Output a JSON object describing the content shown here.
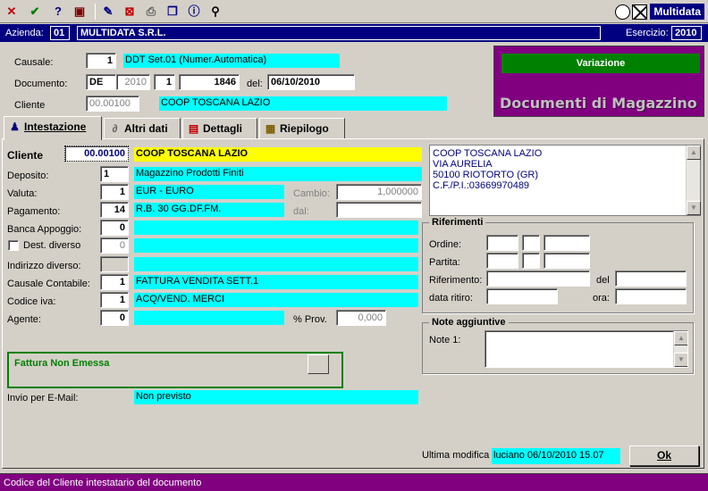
{
  "toolbar": {
    "icons": [
      "close-icon",
      "check-icon",
      "help-icon",
      "book-icon",
      "edit-icon",
      "delete-icon",
      "print-icon",
      "copy-icon",
      "info-icon",
      "search-icon"
    ],
    "brand": "Multidata"
  },
  "azienda": {
    "label": "Azienda:",
    "code": "01",
    "name": "MULTIDATA S.R.L.",
    "esercizio_label": "Esercizio:",
    "esercizio": "2010"
  },
  "header": {
    "causale_label": "Causale:",
    "causale_code": "1",
    "causale_desc": "DDT Set.01 (Numer.Automatica)",
    "documento_label": "Documento:",
    "doc_type": "DE",
    "doc_year": "2010",
    "doc_series": "1",
    "doc_number": "1846",
    "del_label": "del:",
    "doc_date": "06/10/2010",
    "cliente_label": "Cliente",
    "cliente_code": "00.00100",
    "cliente_name": "COOP TOSCANA LAZIO"
  },
  "panel": {
    "status": "Variazione",
    "title": "Documenti di Magazzino"
  },
  "tabs": [
    {
      "label": "Intestazione",
      "icon": "person-icon"
    },
    {
      "label": "Altri dati",
      "icon": "paperclip-icon"
    },
    {
      "label": "Dettagli",
      "icon": "list-icon"
    },
    {
      "label": "Riepilogo",
      "icon": "summary-icon"
    }
  ],
  "form": {
    "cliente_label": "Cliente",
    "cliente_code": "00.00100",
    "cliente_name": "COOP TOSCANA LAZIO",
    "deposito_label": "Deposito:",
    "deposito_code": "1",
    "deposito_desc": "Magazzino Prodotti Finiti",
    "valuta_label": "Valuta:",
    "valuta_code": "1",
    "valuta_desc": "EUR - EURO",
    "cambio_label": "Cambio:",
    "cambio_value": "1,000000",
    "pagamento_label": "Pagamento:",
    "pagamento_code": "14",
    "pagamento_desc": "R.B. 30 GG.DF.FM.",
    "dal_label": "dal:",
    "dal_value": "",
    "banca_label": "Banca Appoggio:",
    "banca_code": "0",
    "dest_label": "Dest. diverso",
    "dest_code": "0",
    "indirizzo_label": "Indirizzo diverso:",
    "indirizzo_code": "",
    "causale_contabile_label": "Causale Contabile:",
    "causale_contabile_code": "1",
    "causale_contabile_desc": "FATTURA VENDITA SETT.1",
    "codice_iva_label": "Codice iva:",
    "codice_iva_code": "1",
    "codice_iva_desc": "ACQ/VEND. MERCI",
    "agente_label": "Agente:",
    "agente_code": "0",
    "prov_label": "% Prov.",
    "prov_value": "0,000",
    "fattura_label": "Fattura Non Emessa",
    "email_label": "Invio per E-Mail:",
    "email_value": "Non previsto"
  },
  "address": {
    "lines": [
      "COOP TOSCANA LAZIO",
      "VIA AURELIA",
      "50100 RIOTORTO (GR)",
      "C.F./P.I.:03669970489"
    ]
  },
  "riferimenti": {
    "title": "Riferimenti",
    "ordine_label": "Ordine:",
    "partita_label": "Partita:",
    "riferimento_label": "Riferimento:",
    "del_label": "del",
    "data_ritiro_label": "data ritiro:",
    "ora_label": "ora:"
  },
  "note": {
    "title": "Note aggiuntive",
    "note1_label": "Note 1:"
  },
  "footer": {
    "ultima_label": "Ultima modifica",
    "ultima_value": "luciano 06/10/2010 15.07",
    "ok_label": "Ok",
    "status": "Codice del Cliente intestatario del documento"
  }
}
